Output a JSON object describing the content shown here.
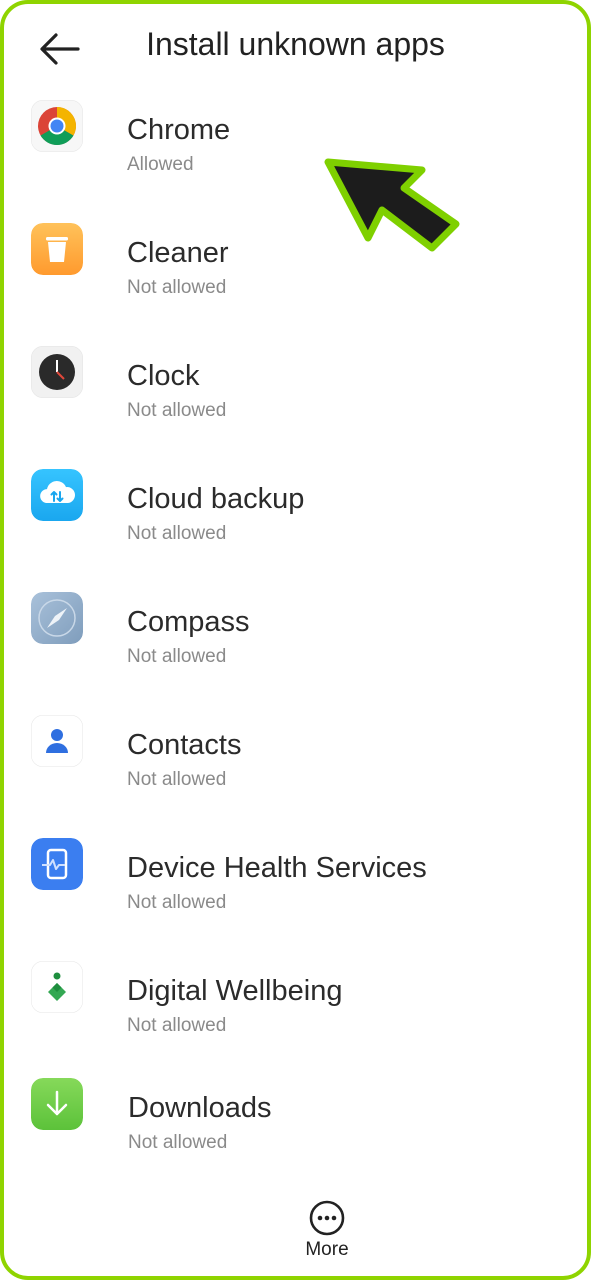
{
  "header": {
    "title": "Install unknown apps",
    "back_icon": "arrow-left"
  },
  "apps": [
    {
      "name": "Chrome",
      "status": "Allowed",
      "icon": "chrome-icon"
    },
    {
      "name": "Cleaner",
      "status": "Not allowed",
      "icon": "trash-icon"
    },
    {
      "name": "Clock",
      "status": "Not allowed",
      "icon": "clock-icon"
    },
    {
      "name": "Cloud backup",
      "status": "Not allowed",
      "icon": "cloud-icon"
    },
    {
      "name": "Compass",
      "status": "Not allowed",
      "icon": "compass-icon"
    },
    {
      "name": "Contacts",
      "status": "Not allowed",
      "icon": "person-icon"
    },
    {
      "name": "Device Health Services",
      "status": "Not allowed",
      "icon": "device-health-icon"
    },
    {
      "name": "Digital Wellbeing",
      "status": "Not allowed",
      "icon": "wellbeing-icon"
    },
    {
      "name": "Downloads",
      "status": "Not allowed",
      "icon": "download-icon"
    }
  ],
  "footer": {
    "more_label": "More",
    "more_icon": "more-dots-icon"
  },
  "colors": {
    "frame_border": "#8fd400",
    "pointer_fill": "#1c1c1c",
    "pointer_outline": "#7fd000"
  }
}
